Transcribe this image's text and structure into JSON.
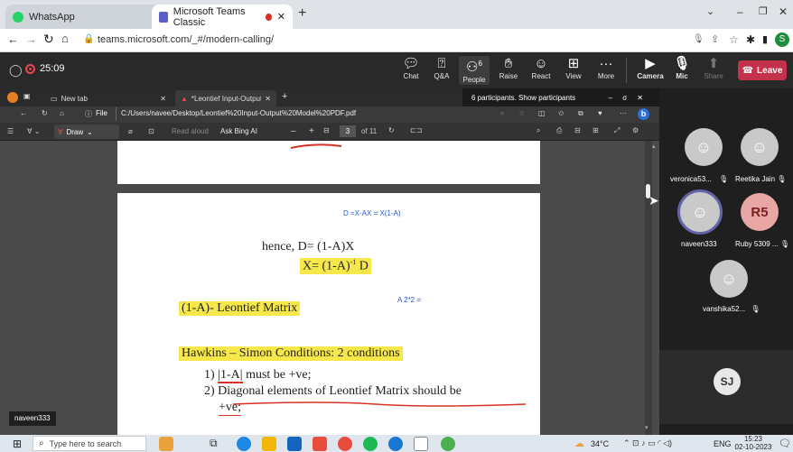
{
  "browser": {
    "tabs": [
      {
        "title": "WhatsApp"
      },
      {
        "title": "Microsoft Teams Classic"
      }
    ],
    "url": "teams.microsoft.com/_#/modern-calling/",
    "profile_initial": "S"
  },
  "teams": {
    "timer": "25:09",
    "buttons": {
      "chat": "Chat",
      "qa": "Q&A",
      "people": "People",
      "people_count": "6",
      "raise": "Raise",
      "react": "React",
      "view": "View",
      "more": "More",
      "camera": "Camera",
      "mic": "Mic",
      "share": "Share",
      "leave": "Leave"
    }
  },
  "shared": {
    "tabs": [
      {
        "title": "New tab"
      },
      {
        "title": "*Leontief Input-Output Model P"
      }
    ],
    "participants_tooltip": "6 participants. Show participants",
    "file_label": "File",
    "pdf_path": "C:/Users/navee/Desktop/Leontief%20Input-Output%20Model%20PDF.pdf",
    "toolbar": {
      "draw": "Draw",
      "read_aloud": "Read aloud",
      "ask_bing": "Ask Bing AI",
      "page": "3",
      "of_pages": "of 11"
    },
    "pdf": {
      "eq_top": "D =X-AX = X(1-A)",
      "hence": "hence, D= (1-A)X",
      "x_eq_pre": "X= (1-A)",
      "x_eq_sup": "-1",
      "x_eq_post": " D",
      "leontief": "(1-A)- Leontief Matrix",
      "a22": "A 2*2 =",
      "hawkins": "Hawkins – Simon Conditions: 2 conditions",
      "cond1_pre": "1) ",
      "cond1_det": "|1-A|",
      "cond1_post": " must be +ve;",
      "cond2": "2) Diagonal elements of Leontief Matrix should be",
      "cond2_end": "+ve;"
    },
    "presenter": "naveen333"
  },
  "participants": [
    {
      "name": "veronica53...",
      "initials": ""
    },
    {
      "name": "Reetika Jain",
      "initials": ""
    },
    {
      "name": "naveen333",
      "initials": ""
    },
    {
      "name": "Ruby 5309 ...",
      "initials": "R5"
    },
    {
      "name": "vanshika52...",
      "initials": ""
    },
    {
      "name": "",
      "initials": "SJ"
    }
  ],
  "taskbar": {
    "search_placeholder": "Type here to search",
    "temperature": "34°C",
    "language": "ENG",
    "time": "15:23",
    "date": "02-10-2023"
  },
  "colors": {
    "leave": "#c4314b",
    "ruby_avatar": "#e8a7a4",
    "sj_avatar": "#e8e8e8",
    "highlight": "#f6e84a"
  }
}
